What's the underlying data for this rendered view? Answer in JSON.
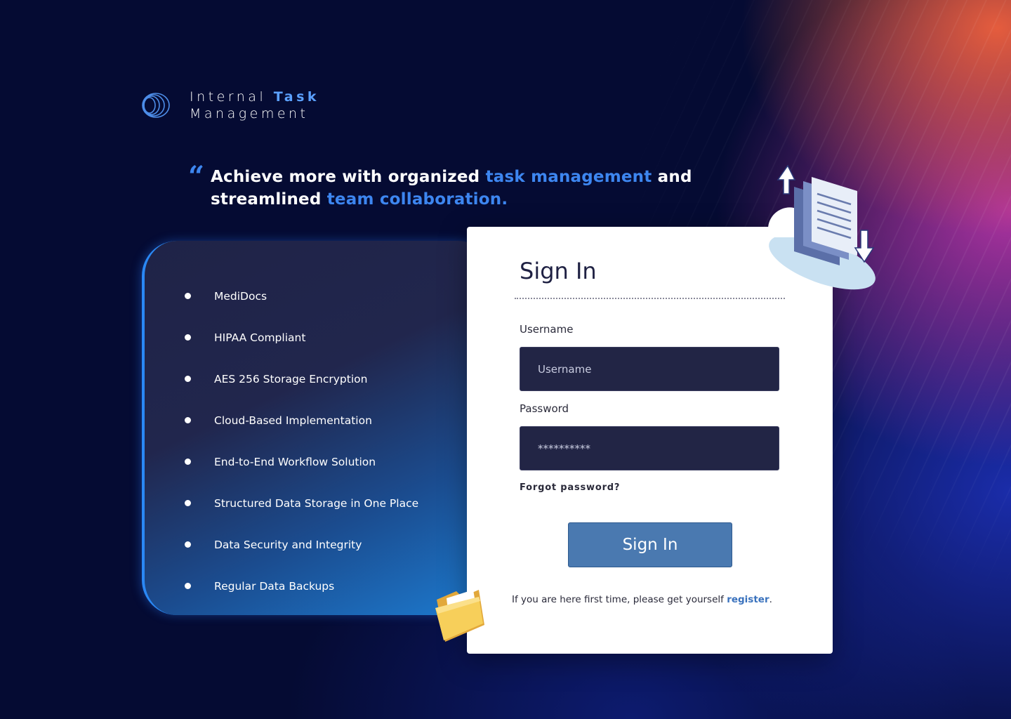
{
  "brand": {
    "line1": "Internal ",
    "line1_highlight": "Task",
    "line2": "Management",
    "logo_icon": "concentric-rings-logo-icon"
  },
  "quote": {
    "mark": "“",
    "part1": "Achieve more with organized ",
    "highlight1": "task management",
    "part2": " and streamlined ",
    "highlight2": "team collaboration."
  },
  "features": {
    "items": [
      "MediDocs",
      "HIPAA Compliant",
      "AES 256 Storage Encryption",
      "Cloud-Based Implementation",
      "End-to-End Workflow Solution",
      "Structured Data Storage in One Place",
      "Data Security and Integrity",
      "Regular Data Backups"
    ]
  },
  "signin": {
    "title": "Sign In",
    "username_label": "Username",
    "username_placeholder": "Username",
    "username_value": "",
    "password_label": "Password",
    "password_value": "**********",
    "forgot_label": "Forgot password?",
    "submit_label": "Sign In",
    "register_prompt": "If you are here first time, please get yourself ",
    "register_link": "register",
    "register_suffix": "."
  },
  "decorations": {
    "cloud_icon": "cloud-documents-icon",
    "folder_icon": "folder-icon"
  },
  "colors": {
    "accent": "#3d86f0",
    "brand_highlight": "#5ba0ff",
    "background": "#050b33",
    "input_bg": "#222545",
    "button_bg": "#4a79b0",
    "link": "#3a72bd"
  }
}
